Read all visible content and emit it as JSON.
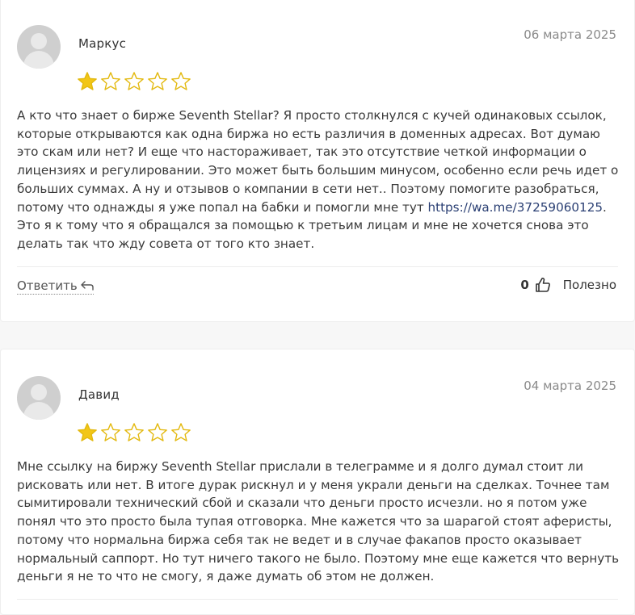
{
  "reviews": [
    {
      "author": "Маркус",
      "date": "06 марта 2025",
      "rating": 1,
      "max_rating": 5,
      "text_before_link": "А кто что знает о бирже Seventh Stellar? Я просто столкнулся с кучей одинаковых ссылок, которые открываются как одна биржа но есть различия в доменных адресах. Вот думаю это скам или нет? И еще что настораживает, так это отсутствие четкой информации о лицензиях и регулировании. Это может быть большим минусом, особенно если речь идет о больших суммах. А ну и отзывов о компании в сети нет.. Поэтому помогите разобраться, потому что однажды я уже попал на бабки и помогли мне тут ",
      "link": "https://wa.me/37259060125",
      "text_after_link": ". Это я к тому что я обращался за помощью к третьим лицам и мне не хочется снова это делать так что жду совета от того кто знает.",
      "reply_label": "Ответить",
      "helpful_count": "0",
      "helpful_label": "Полезно"
    },
    {
      "author": "Давид",
      "date": "04 марта 2025",
      "rating": 1,
      "max_rating": 5,
      "text": "Мне ссылку на биржу Seventh Stellar прислали в телеграмме и я долго думал стоит ли рисковать или нет. В итоге дурак рискнул и у меня украли деньги на сделках. Точнее там сымитировали технический сбой и сказали что деньги просто исчезли. но я потом уже понял что это просто была тупая отговорка. Мне кажется что за шарагой стоят аферисты, потому что нормальна биржа себя так не ведет и в случае факапов просто оказывает нормальный саппорт. Но тут ничего такого не было. Поэтому мне еще кажется что вернуть деньги я не то что не смогу, я даже думать об этом не должен."
    }
  ],
  "colors": {
    "star_fill": "#f2c617",
    "star_outline": "#e3b90f",
    "link": "#2a3f73"
  },
  "icons": [
    "user-avatar-icon",
    "star-icon",
    "reply-arrow-icon",
    "thumbs-up-icon"
  ]
}
